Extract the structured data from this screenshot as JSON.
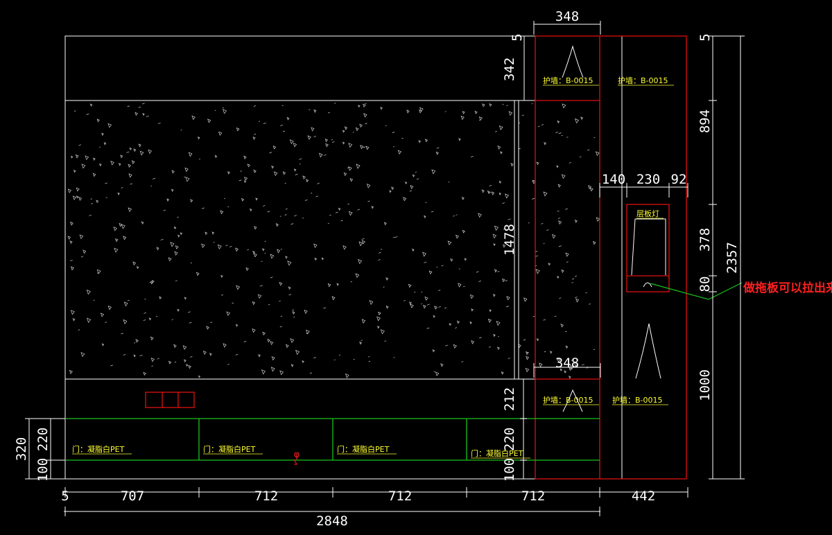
{
  "drawing": {
    "dimensions": {
      "d348_top": "348",
      "d5_left": "5",
      "d342": "342",
      "d5_right": "5",
      "d894": "894",
      "d140": "140",
      "d230": "230",
      "d92": "92",
      "d378": "378",
      "d80": "80",
      "d2357": "2357",
      "d1478": "1478",
      "d348_mid": "348",
      "d212": "212",
      "d1000": "1000",
      "d220_left": "220",
      "d320": "320",
      "d100_left": "100",
      "d220_mid": "220",
      "d100_mid": "100",
      "d5_bottom": "5",
      "d707": "707",
      "d712_a": "712",
      "d712_b": "712",
      "d712_c": "712",
      "d442": "442",
      "d2848": "2848"
    },
    "labels": {
      "wall_1": "护墙：B-0015",
      "wall_2": "护墙：B-0015",
      "wall_3": "护墙：B-0015",
      "wall_4": "护墙：B-0015",
      "shelf_light": "层板灯",
      "door_1": "门：凝脂白PET",
      "door_2": "门：凝脂白PET",
      "door_3": "门：凝脂白PET",
      "door_4": "门：凝脂白PET",
      "pull_note": "做拖板可以拉出来",
      "phi": "φ"
    },
    "colors": {
      "background": "#000000",
      "lines": "#ffffff",
      "cabinet": "#e01010",
      "doors": "#19c419",
      "labels": "#ffff33",
      "note": "#ff2020",
      "leader": "#19c419"
    }
  }
}
